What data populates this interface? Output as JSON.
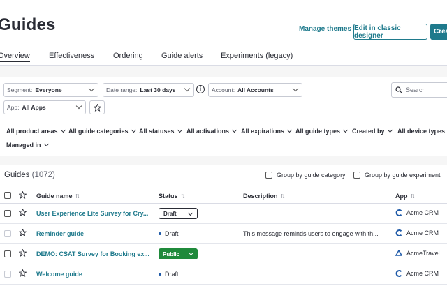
{
  "header": {
    "title": "Guides",
    "manage_themes": "Manage themes",
    "classic_designer": "Edit in classic designer",
    "create": "Create"
  },
  "tabs": [
    "Overview",
    "Effectiveness",
    "Ordering",
    "Guide alerts",
    "Experiments (legacy)"
  ],
  "filters": {
    "segment_label": "Segment:",
    "segment_value": "Everyone",
    "date_label": "Date range:",
    "date_value": "Last 30 days",
    "account_label": "Account:",
    "account_value": "All Accounts",
    "app_label": "App:",
    "app_value": "All Apps",
    "search_placeholder": "Search"
  },
  "chips": [
    "All product areas",
    "All guide categories",
    "All statuses",
    "All activations",
    "All expirations",
    "All guide types",
    "Created by",
    "All device types",
    "Managed in"
  ],
  "table": {
    "title": "Guides",
    "count": "(1072)",
    "group_category": "Group by guide category",
    "group_experiment": "Group by guide experiment",
    "columns": {
      "name": "Guide name",
      "status": "Status",
      "description": "Description",
      "app": "App"
    },
    "rows": [
      {
        "name": "User Experience Lite Survey for Cry...",
        "status": "Draft",
        "status_style": "dropdown-draft",
        "description": "",
        "app": "Acme CRM",
        "app_icon": "acme-crm-icon"
      },
      {
        "name": "Reminder guide",
        "status": "Draft",
        "status_style": "dot",
        "description": "This message reminds users to engage with th...",
        "app": "Acme CRM",
        "app_icon": "acme-crm-icon"
      },
      {
        "name": "DEMO: CSAT Survey for Booking ex...",
        "status": "Public",
        "status_style": "dropdown-public",
        "description": "",
        "app": "AcmeTravel",
        "app_icon": "acme-travel-icon"
      },
      {
        "name": "Welcome guide",
        "status": "Draft",
        "status_style": "dot",
        "description": "",
        "app": "Acme CRM",
        "app_icon": "acme-crm-icon"
      }
    ]
  },
  "colors": {
    "accent": "#1f7a8c",
    "public": "#1f8a3b",
    "text": "#2a2c35"
  }
}
